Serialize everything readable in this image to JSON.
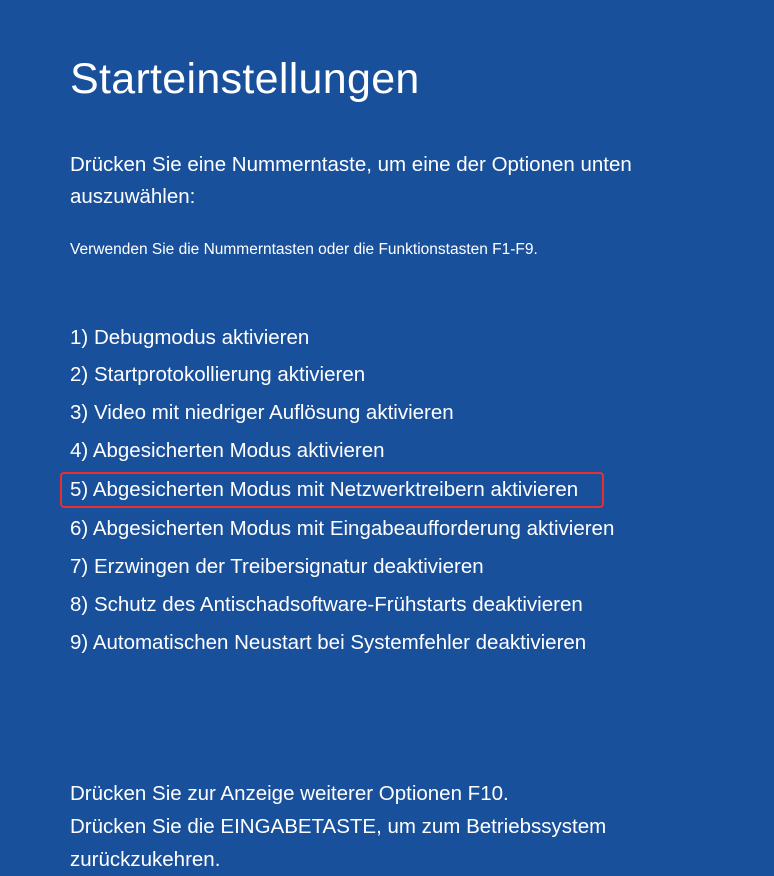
{
  "title": "Starteinstellungen",
  "instruction": "Drücken Sie eine Nummerntaste, um eine der Optionen unten auszuwählen:",
  "hint": "Verwenden Sie die Nummerntasten oder die Funktionstasten F1-F9.",
  "options": [
    {
      "num": "1)",
      "label": "Debugmodus aktivieren"
    },
    {
      "num": "2)",
      "label": "Startprotokollierung aktivieren"
    },
    {
      "num": "3)",
      "label": "Video mit niedriger Auflösung aktivieren"
    },
    {
      "num": "4)",
      "label": "Abgesicherten Modus aktivieren"
    },
    {
      "num": "5)",
      "label": "Abgesicherten Modus mit Netzwerktreibern aktivieren"
    },
    {
      "num": "6)",
      "label": "Abgesicherten Modus mit Eingabeaufforderung aktivieren"
    },
    {
      "num": "7)",
      "label": "Erzwingen der Treibersignatur deaktivieren"
    },
    {
      "num": "8)",
      "label": "Schutz des Antischadsoftware-Frühstarts deaktivieren"
    },
    {
      "num": "9)",
      "label": "Automatischen Neustart bei Systemfehler deaktivieren"
    }
  ],
  "highlighted_index": 4,
  "footer_line1": "Drücken Sie zur Anzeige weiterer Optionen F10.",
  "footer_line2": "Drücken Sie die EINGABETASTE, um zum Betriebssystem zurückzukehren."
}
